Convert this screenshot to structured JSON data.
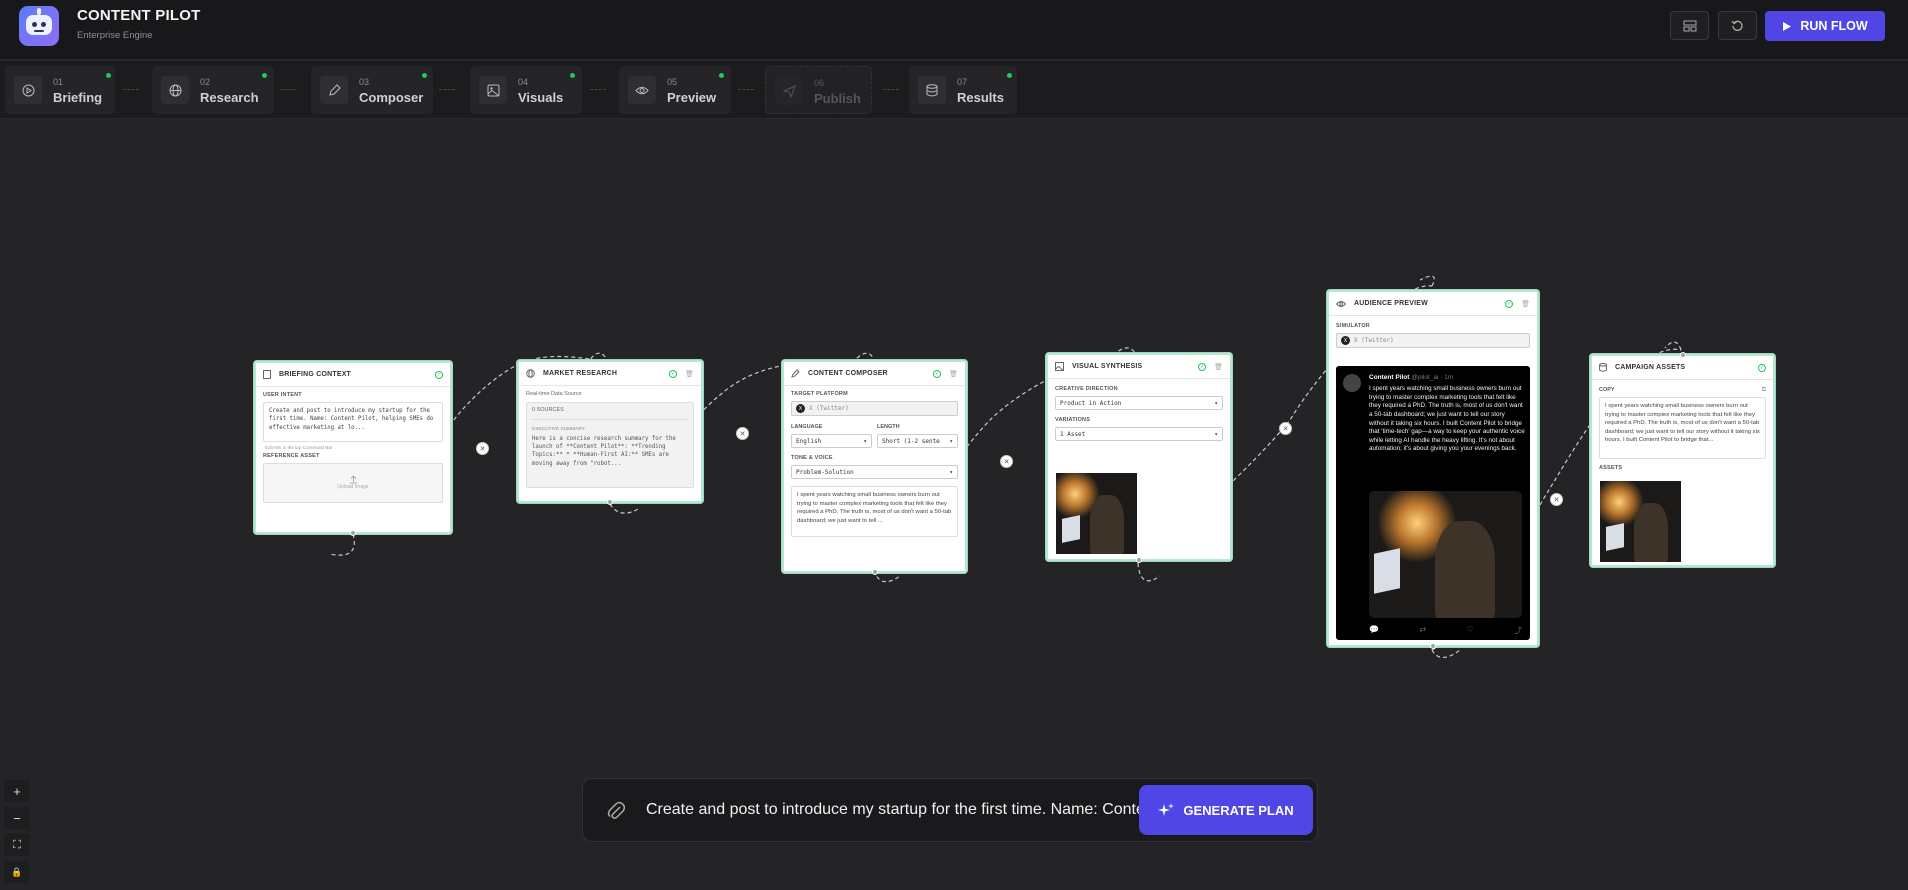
{
  "app": {
    "title": "CONTENT PILOT",
    "subtitle": "Enterprise Engine"
  },
  "toolbar": {
    "layout_icon": "layout-icon",
    "reset_icon": "reset-icon",
    "run_label": "RUN FLOW"
  },
  "steps": [
    {
      "num": "01",
      "label": "Briefing",
      "icon": "play-icon",
      "done": true,
      "enabled": true
    },
    {
      "num": "02",
      "label": "Research",
      "icon": "globe-icon",
      "done": true,
      "enabled": true
    },
    {
      "num": "03",
      "label": "Composer",
      "icon": "pen-icon",
      "done": true,
      "enabled": true
    },
    {
      "num": "04",
      "label": "Visuals",
      "icon": "image-icon",
      "done": true,
      "enabled": true
    },
    {
      "num": "05",
      "label": "Preview",
      "icon": "eye-icon",
      "done": true,
      "enabled": true
    },
    {
      "num": "06",
      "label": "Publish",
      "icon": "send-icon",
      "done": false,
      "enabled": false
    },
    {
      "num": "07",
      "label": "Results",
      "icon": "database-icon",
      "done": true,
      "enabled": true
    }
  ],
  "nodes": {
    "briefing": {
      "title": "BRIEFING CONTEXT",
      "intent_label": "USER INTENT",
      "intent_text": "Create and post to introduce my startup for the first time. Name: Content Pilot, helping SMEs do effective marketing at lo...",
      "hint": "Edit this in the top Command Bar",
      "ref_label": "REFERENCE ASSET",
      "upload_label": "Upload Image"
    },
    "research": {
      "title": "MARKET RESEARCH",
      "source_label": "Real-time Data Source",
      "sources": "0 SOURCES",
      "summary_label": "EXECUTIVE SUMMARY",
      "summary_text": "Here is a concise research summary for the launch of **Content Pilot**: **Trending Topics:** * **Human-First AI:** SMEs are moving away from \"robot..."
    },
    "composer": {
      "title": "CONTENT COMPOSER",
      "platform_label": "TARGET PLATFORM",
      "platform_value": "X (Twitter)",
      "language_label": "LANGUAGE",
      "language_value": "English",
      "length_label": "LENGTH",
      "length_value": "Short (1-2 sente",
      "tone_label": "TONE & VOICE",
      "tone_value": "Problem-Solution",
      "draft": "I spent years watching small business owners burn out trying to master complex marketing tools that felt like they required a PhD. The truth is, most of us don't want a 50-tab dashboard; we just want to tell ..."
    },
    "visuals": {
      "title": "VISUAL SYNTHESIS",
      "direction_label": "CREATIVE DIRECTION",
      "direction_value": "Product in Action",
      "variations_label": "VARIATIONS",
      "variations_value": "1 Asset"
    },
    "preview": {
      "title": "AUDIENCE PREVIEW",
      "simulator_label": "SIMULATOR",
      "simulator_value": "X (Twitter)",
      "author": "Content Pilot",
      "handle": "@pilot_ai · 1m",
      "post": "I spent years watching small business owners burn out trying to master complex marketing tools that felt like they required a PhD. The truth is, most of us don't want a 50-tab dashboard; we just want to tell our story without it taking six hours. I built Content Pilot to bridge that 'time-tech' gap—a way to keep your authentic voice while letting AI handle the heavy lifting. It's not about automation; it's about giving you your evenings back."
    },
    "assets": {
      "title": "CAMPAIGN ASSETS",
      "copy_label": "COPY",
      "copy_text": "I spent years watching small business owners burn out trying to master complex marketing tools that felt like they required a PhD. The truth is, most of us don't want a 50-tab dashboard; we just want to tell our story without it taking six hours. I built Content Pilot to bridge that...",
      "assets_label": "ASSETS"
    }
  },
  "zoom_controls": [
    "+",
    "−",
    "⛶",
    "🔒"
  ],
  "command_bar": {
    "text": "Create and post to introduce my startup for the first time. Name: Content Pilot, helping SMEs do effective marketing at low cost",
    "button": "GENERATE PLAN"
  },
  "colors": {
    "accent": "#4f46e5",
    "success": "#22c55e",
    "canvas": "#242426",
    "node_border": "#b7e6cf"
  }
}
